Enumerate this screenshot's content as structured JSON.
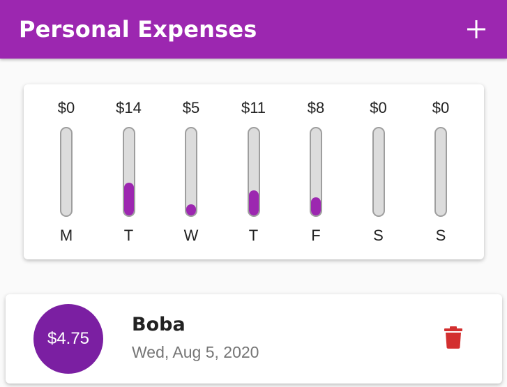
{
  "app": {
    "title": "Personal Expenses",
    "add_icon": "plus-icon",
    "primary_color": "#9c27b0"
  },
  "chart_data": {
    "type": "bar",
    "categories": [
      "M",
      "T",
      "W",
      "T",
      "F",
      "S",
      "S"
    ],
    "labels": [
      "$0",
      "$14",
      "$5",
      "$11",
      "$8",
      "$0",
      "$0"
    ],
    "values": [
      0,
      14.25,
      4.75,
      11,
      8,
      0,
      0
    ],
    "fill_fraction": [
      0,
      0.375,
      0.125,
      0.29,
      0.21,
      0,
      0
    ],
    "bar_color": "#9c27b0",
    "track_color": "#dcdcdc"
  },
  "transactions": [
    {
      "amount": "$4.75",
      "title": "Boba",
      "date": "Wed, Aug 5, 2020",
      "delete_icon": "trash-icon",
      "delete_color": "#d32f2f"
    }
  ]
}
